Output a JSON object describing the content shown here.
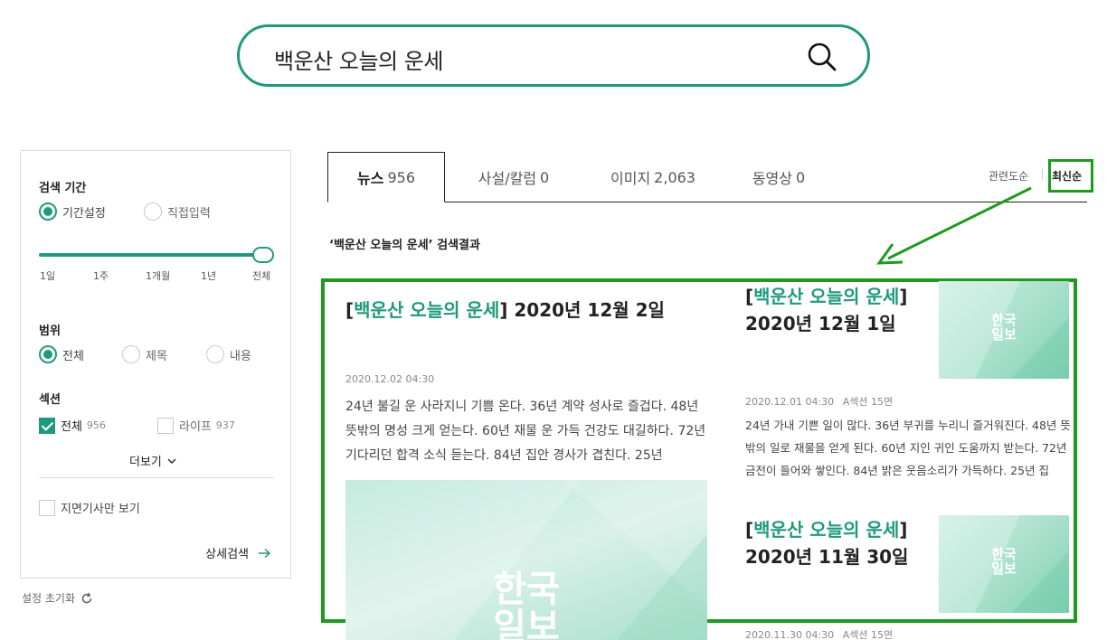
{
  "search": {
    "query": "백운산 오늘의 운세"
  },
  "filter": {
    "period_title": "검색 기간",
    "period_options": [
      "기간설정",
      "직접입력"
    ],
    "period_ticks": [
      "1일",
      "1주",
      "1개월",
      "1년",
      "전체"
    ],
    "period_selected_index": 4,
    "scope_title": "범위",
    "scope_options": [
      "전체",
      "제목",
      "내용"
    ],
    "section_title": "섹션",
    "sections": [
      {
        "label": "전체",
        "count": "956",
        "checked": true
      },
      {
        "label": "라이프",
        "count": "937",
        "checked": false
      }
    ],
    "more_label": "더보기",
    "paper_only_label": "지면기사만 보기",
    "detail_search_label": "상세검색",
    "reset_label": "설정 초기화"
  },
  "tabs": [
    {
      "label": "뉴스",
      "count": "956"
    },
    {
      "label": "사설/칼럼",
      "count": "0"
    },
    {
      "label": "이미지",
      "count": "2,063"
    },
    {
      "label": "동영상",
      "count": "0"
    }
  ],
  "sort": {
    "relevance": "관련도순",
    "latest": "최신순"
  },
  "results_label": "‘백운산 오늘의 운세’ 검색결과",
  "articles": [
    {
      "keyword": "백운산 오늘의 운세",
      "title_rest": "2020년 12월 2일",
      "date": "2020.12.02 04:30",
      "section": "",
      "body": "24년 불길 운 사라지니 기쁨 온다. 36년 계약 성사로 즐겁다. 48년 뜻밖의 명성 크게 얻는다. 60년 재물 운 가득 건강도 대길하다. 72년 기다리던 합격 소식 듣는다. 84년 집안 경사가 겹친다. 25년"
    },
    {
      "keyword": "백운산 오늘의 운세",
      "title_rest": "2020년 12월 1일",
      "date": "2020.12.01 04:30",
      "section": "A섹션 15면",
      "body": "24년 가내 기쁜 일이 많다. 36년 부귀를 누리니 즐거워진다. 48년 뜻밖의 일로 재물을 얻게 된다. 60년 지인 귀인 도움까지 받는다. 72년 금전이 들어와 쌓인다. 84년 밝은 웃음소리가 가득하다. 25년 집"
    },
    {
      "keyword": "백운산 오늘의 운세",
      "title_rest": "2020년 11월 30일",
      "date": "2020.11.30 04:30",
      "section": "A섹션 15면"
    }
  ],
  "thumbnail_logo": "한국\n일보",
  "colors": {
    "accent": "#1e9a7e",
    "annotation": "#1f9a1f"
  }
}
